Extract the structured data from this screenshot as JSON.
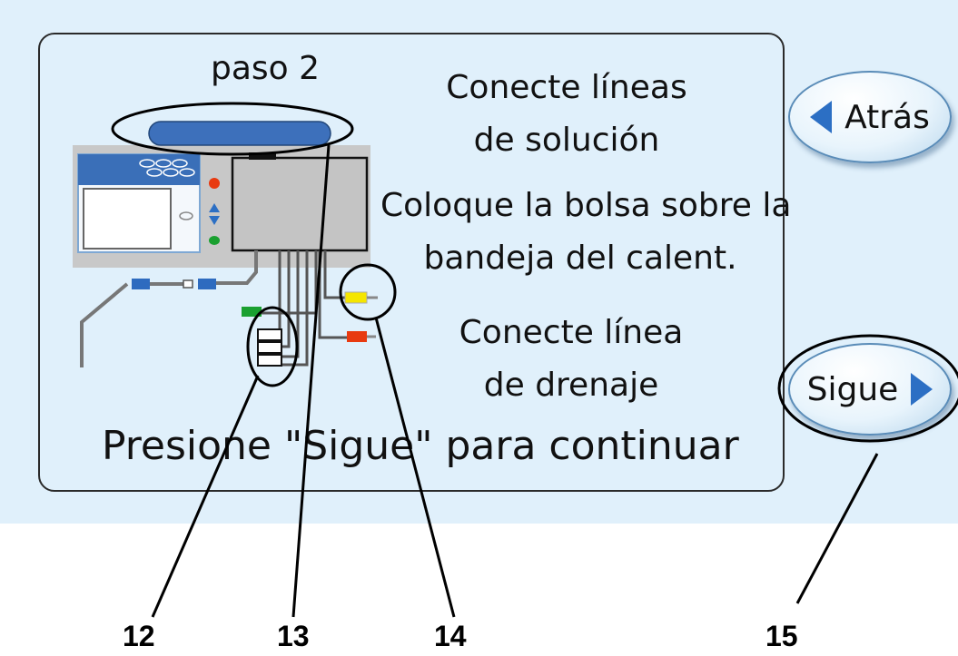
{
  "step": {
    "title": "paso 2"
  },
  "instructions": [
    {
      "line1": "Conecte líneas",
      "line2": "de solución"
    },
    {
      "line1": "Coloque la bolsa sobre la",
      "line2": "bandeja del calent."
    },
    {
      "line1": "Conecte línea",
      "line2": "de drenaje"
    }
  ],
  "prompt": "Presione \"Sigue\" para continuar",
  "nav": {
    "back_label": "Atrás",
    "next_label": "Sigue"
  },
  "callouts": [
    "12",
    "13",
    "14",
    "15"
  ],
  "icons": {
    "back": "left-triangle-icon",
    "next": "right-triangle-icon"
  },
  "colors": {
    "screen_bg": "#e0f0fb",
    "accent_blue": "#2c6fc4",
    "line_yellow": "#f5e600",
    "line_red": "#e83a10",
    "line_green": "#1aa030",
    "connector_blue": "#2e6bbf"
  }
}
